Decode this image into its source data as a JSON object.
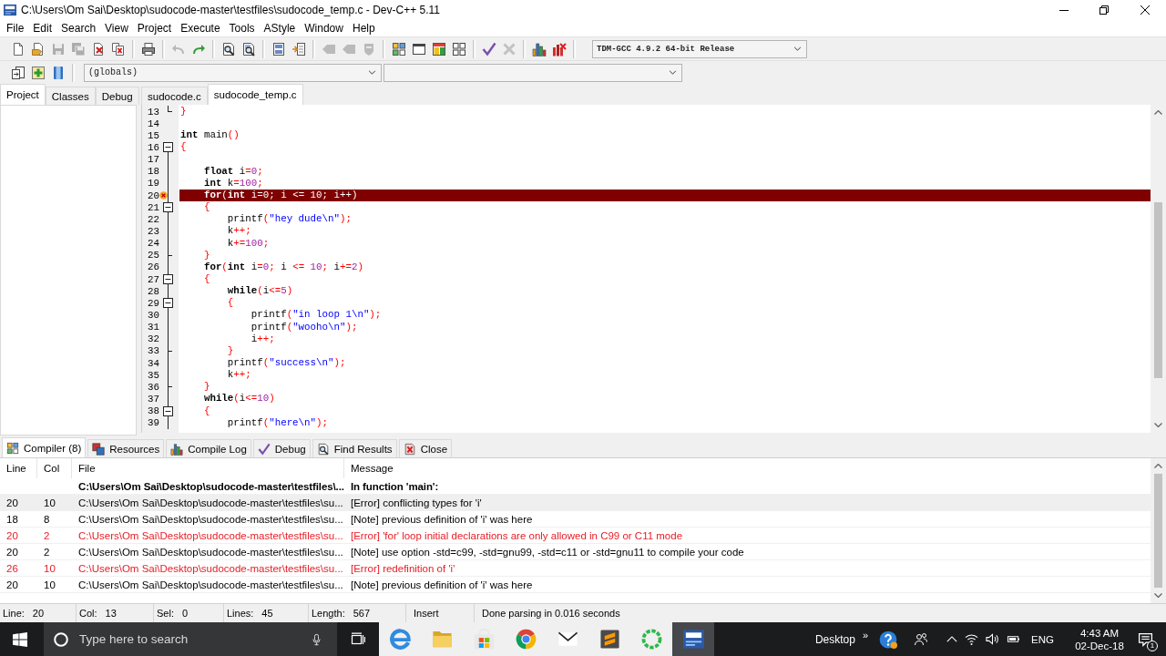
{
  "window": {
    "title": "C:\\Users\\Om Sai\\Desktop\\sudocode-master\\testfiles\\sudocode_temp.c - Dev-C++ 5.11"
  },
  "menu": [
    "File",
    "Edit",
    "Search",
    "View",
    "Project",
    "Execute",
    "Tools",
    "AStyle",
    "Window",
    "Help"
  ],
  "toolbar": {
    "groups": [
      [
        {
          "disabled": false
        },
        {
          "disabled": false
        },
        {
          "disabled": true
        },
        {
          "disabled": true
        },
        {
          "disabled": false
        },
        {
          "disabled": false
        }
      ],
      [
        {
          "disabled": false
        }
      ],
      [
        {
          "disabled": true
        },
        {
          "disabled": false
        }
      ],
      [
        {
          "disabled": false
        },
        {
          "disabled": false
        }
      ],
      [
        {
          "disabled": false
        },
        {
          "disabled": false
        }
      ],
      [
        {
          "disabled": true
        },
        {
          "disabled": true
        },
        {
          "disabled": true
        }
      ],
      [
        {
          "disabled": false
        },
        {
          "disabled": false
        },
        {
          "disabled": false
        },
        {
          "disabled": false
        }
      ],
      [
        {
          "disabled": false
        },
        {
          "disabled": true
        }
      ],
      [
        {
          "disabled": false
        },
        {
          "disabled": false
        }
      ]
    ],
    "compiler": "TDM-GCC 4.9.2 64-bit Release"
  },
  "toolbar_2": {
    "buttons": [
      {
        "disabled": false
      },
      {
        "disabled": false
      },
      {
        "disabled": false
      }
    ],
    "scope": "(globals)"
  },
  "side_panel": {
    "tabs": [
      {
        "label": "Project",
        "selected": true
      },
      {
        "label": "Classes",
        "selected": false
      },
      {
        "label": "Debug",
        "selected": false
      }
    ]
  },
  "editor": {
    "tabs": [
      {
        "label": "sudocode.c",
        "selected": false
      },
      {
        "label": "sudocode_temp.c",
        "selected": true
      }
    ],
    "lines": [
      {
        "number": "13",
        "kind": "fold-end",
        "error": false,
        "tokens": [
          {
            "kind": "symbol",
            "text": "}"
          }
        ]
      },
      {
        "number": "14",
        "kind": "plain",
        "error": false
      },
      {
        "number": "15",
        "kind": "plain",
        "error": false,
        "tokens": [
          {
            "kind": "keyword",
            "text": "int"
          },
          {
            "kind": "plain",
            "text": " main"
          },
          {
            "kind": "symbol",
            "text": "()"
          }
        ]
      },
      {
        "number": "16",
        "kind": "fold-start",
        "error": false,
        "tokens": [
          {
            "kind": "symbol",
            "text": "{"
          }
        ]
      },
      {
        "number": "17",
        "kind": "fold-inside",
        "error": false
      },
      {
        "number": "18",
        "kind": "fold-inside",
        "error": false,
        "tokens": [
          {
            "kind": "keyword",
            "text": "    float"
          },
          {
            "kind": "plain",
            "text": " i"
          },
          {
            "kind": "symbol",
            "text": "="
          },
          {
            "kind": "number",
            "text": "0"
          },
          {
            "kind": "symbol",
            "text": ";"
          }
        ]
      },
      {
        "number": "19",
        "kind": "fold-inside",
        "error": false,
        "tokens": [
          {
            "kind": "keyword",
            "text": "    int"
          },
          {
            "kind": "plain",
            "text": " k"
          },
          {
            "kind": "symbol",
            "text": "="
          },
          {
            "kind": "number",
            "text": "100"
          },
          {
            "kind": "symbol",
            "text": ";"
          }
        ]
      },
      {
        "number": "20",
        "kind": "fold-inside",
        "error": true,
        "tokens": [
          {
            "kind": "keyword",
            "text": "    for"
          },
          {
            "kind": "symbol",
            "text": "("
          },
          {
            "kind": "keyword",
            "text": "int"
          },
          {
            "kind": "plain",
            "text": " i"
          },
          {
            "kind": "symbol",
            "text": "="
          },
          {
            "kind": "number",
            "text": "0"
          },
          {
            "kind": "symbol",
            "text": ";"
          },
          {
            "kind": "plain",
            "text": " i "
          },
          {
            "kind": "symbol",
            "text": "<="
          },
          {
            "kind": "number",
            "text": " 10"
          },
          {
            "kind": "symbol",
            "text": ";"
          },
          {
            "kind": "plain",
            "text": " i"
          },
          {
            "kind": "symbol",
            "text": "++)"
          }
        ]
      },
      {
        "number": "21",
        "kind": "fold-start",
        "error": false,
        "tokens": [
          {
            "kind": "symbol",
            "text": "    {"
          }
        ]
      },
      {
        "number": "22",
        "kind": "fold-inside",
        "error": false,
        "tokens": [
          {
            "kind": "plain",
            "text": "        printf"
          },
          {
            "kind": "symbol",
            "text": "("
          },
          {
            "kind": "string",
            "text": "\"hey dude\\n\""
          },
          {
            "kind": "symbol",
            "text": ");"
          }
        ]
      },
      {
        "number": "23",
        "kind": "fold-inside",
        "error": false,
        "tokens": [
          {
            "kind": "plain",
            "text": "        k"
          },
          {
            "kind": "symbol",
            "text": "++;"
          }
        ]
      },
      {
        "number": "24",
        "kind": "fold-inside",
        "error": false,
        "tokens": [
          {
            "kind": "plain",
            "text": "        k"
          },
          {
            "kind": "symbol",
            "text": "+="
          },
          {
            "kind": "number",
            "text": "100"
          },
          {
            "kind": "symbol",
            "text": ";"
          }
        ]
      },
      {
        "number": "25",
        "kind": "fold-branch",
        "error": false,
        "tokens": [
          {
            "kind": "symbol",
            "text": "    }"
          }
        ]
      },
      {
        "number": "26",
        "kind": "fold-inside",
        "error": false,
        "tokens": [
          {
            "kind": "keyword",
            "text": "    for"
          },
          {
            "kind": "symbol",
            "text": "("
          },
          {
            "kind": "keyword",
            "text": "int"
          },
          {
            "kind": "plain",
            "text": " i"
          },
          {
            "kind": "symbol",
            "text": "="
          },
          {
            "kind": "number",
            "text": "0"
          },
          {
            "kind": "symbol",
            "text": ";"
          },
          {
            "kind": "plain",
            "text": " i "
          },
          {
            "kind": "symbol",
            "text": "<="
          },
          {
            "kind": "number",
            "text": " 10"
          },
          {
            "kind": "symbol",
            "text": ";"
          },
          {
            "kind": "plain",
            "text": " i"
          },
          {
            "kind": "symbol",
            "text": "+="
          },
          {
            "kind": "number",
            "text": "2"
          },
          {
            "kind": "symbol",
            "text": ")"
          }
        ]
      },
      {
        "number": "27",
        "kind": "fold-start",
        "error": false,
        "tokens": [
          {
            "kind": "symbol",
            "text": "    {"
          }
        ]
      },
      {
        "number": "28",
        "kind": "fold-inside",
        "error": false,
        "tokens": [
          {
            "kind": "keyword",
            "text": "        while"
          },
          {
            "kind": "symbol",
            "text": "("
          },
          {
            "kind": "plain",
            "text": "i"
          },
          {
            "kind": "symbol",
            "text": "<="
          },
          {
            "kind": "number",
            "text": "5"
          },
          {
            "kind": "symbol",
            "text": ")"
          }
        ]
      },
      {
        "number": "29",
        "kind": "fold-start",
        "error": false,
        "tokens": [
          {
            "kind": "symbol",
            "text": "        {"
          }
        ]
      },
      {
        "number": "30",
        "kind": "fold-inside",
        "error": false,
        "tokens": [
          {
            "kind": "plain",
            "text": "            printf"
          },
          {
            "kind": "symbol",
            "text": "("
          },
          {
            "kind": "string",
            "text": "\"in loop 1\\n\""
          },
          {
            "kind": "symbol",
            "text": ");"
          }
        ]
      },
      {
        "number": "31",
        "kind": "fold-inside",
        "error": false,
        "tokens": [
          {
            "kind": "plain",
            "text": "            printf"
          },
          {
            "kind": "symbol",
            "text": "("
          },
          {
            "kind": "string",
            "text": "\"wooho\\n\""
          },
          {
            "kind": "symbol",
            "text": ");"
          }
        ]
      },
      {
        "number": "32",
        "kind": "fold-inside",
        "error": false,
        "tokens": [
          {
            "kind": "plain",
            "text": "            i"
          },
          {
            "kind": "symbol",
            "text": "++;"
          }
        ]
      },
      {
        "number": "33",
        "kind": "fold-branch",
        "error": false,
        "tokens": [
          {
            "kind": "symbol",
            "text": "        }"
          }
        ]
      },
      {
        "number": "34",
        "kind": "fold-inside",
        "error": false,
        "tokens": [
          {
            "kind": "plain",
            "text": "        printf"
          },
          {
            "kind": "symbol",
            "text": "("
          },
          {
            "kind": "string",
            "text": "\"success\\n\""
          },
          {
            "kind": "symbol",
            "text": ");"
          }
        ]
      },
      {
        "number": "35",
        "kind": "fold-inside",
        "error": false,
        "tokens": [
          {
            "kind": "plain",
            "text": "        k"
          },
          {
            "kind": "symbol",
            "text": "++;"
          }
        ]
      },
      {
        "number": "36",
        "kind": "fold-branch",
        "error": false,
        "tokens": [
          {
            "kind": "symbol",
            "text": "    }"
          }
        ]
      },
      {
        "number": "37",
        "kind": "fold-inside",
        "error": false,
        "tokens": [
          {
            "kind": "keyword",
            "text": "    while"
          },
          {
            "kind": "symbol",
            "text": "("
          },
          {
            "kind": "plain",
            "text": "i"
          },
          {
            "kind": "symbol",
            "text": "<="
          },
          {
            "kind": "number",
            "text": "10"
          },
          {
            "kind": "symbol",
            "text": ")"
          }
        ]
      },
      {
        "number": "38",
        "kind": "fold-start",
        "error": false,
        "tokens": [
          {
            "kind": "symbol",
            "text": "    {"
          }
        ]
      },
      {
        "number": "39",
        "kind": "fold-inside",
        "error": false,
        "tokens": [
          {
            "kind": "plain",
            "text": "        printf"
          },
          {
            "kind": "symbol",
            "text": "("
          },
          {
            "kind": "string",
            "text": "\"here\\n\""
          },
          {
            "kind": "symbol",
            "text": ");"
          }
        ]
      }
    ]
  },
  "output_panel": {
    "tabs": [
      {
        "label": "Compiler (8)",
        "selected": true
      },
      {
        "label": "Resources",
        "selected": false
      },
      {
        "label": "Compile Log",
        "selected": false
      },
      {
        "label": "Debug",
        "selected": false
      },
      {
        "label": "Find Results",
        "selected": false
      },
      {
        "label": "Close",
        "selected": false
      }
    ],
    "table": {
      "columns": [
        "Line",
        "Col",
        "File",
        "Message"
      ],
      "rows": [
        {
          "kind": "context",
          "selected": false,
          "color": "#000000",
          "file": "C:\\Users\\Om Sai\\Desktop\\sudocode-master\\testfiles\\...",
          "message": "In function 'main':"
        },
        {
          "kind": "message",
          "selected": true,
          "color": "#000000",
          "line": "20",
          "col": "10",
          "file": "C:\\Users\\Om Sai\\Desktop\\sudocode-master\\testfiles\\su...",
          "message": "[Error] conflicting types for 'i'"
        },
        {
          "kind": "message",
          "selected": false,
          "color": "#000000",
          "line": "18",
          "col": "8",
          "file": "C:\\Users\\Om Sai\\Desktop\\sudocode-master\\testfiles\\su...",
          "message": "[Note] previous definition of 'i' was here"
        },
        {
          "kind": "message",
          "selected": false,
          "color": "#e81c24",
          "line": "20",
          "col": "2",
          "file": "C:\\Users\\Om Sai\\Desktop\\sudocode-master\\testfiles\\su...",
          "message": "[Error] 'for' loop initial declarations are only allowed in C99 or C11 mode"
        },
        {
          "kind": "message",
          "selected": false,
          "color": "#000000",
          "line": "20",
          "col": "2",
          "file": "C:\\Users\\Om Sai\\Desktop\\sudocode-master\\testfiles\\su...",
          "message": "[Note] use option -std=c99, -std=gnu99, -std=c11 or -std=gnu11 to compile your code"
        },
        {
          "kind": "message",
          "selected": false,
          "color": "#e81c24",
          "line": "26",
          "col": "10",
          "file": "C:\\Users\\Om Sai\\Desktop\\sudocode-master\\testfiles\\su...",
          "message": "[Error] redefinition of 'i'"
        },
        {
          "kind": "message",
          "selected": false,
          "color": "#000000",
          "line": "20",
          "col": "10",
          "file": "C:\\Users\\Om Sai\\Desktop\\sudocode-master\\testfiles\\su...",
          "message": "[Note] previous definition of 'i' was here"
        }
      ]
    }
  },
  "status_bar": {
    "fields": [
      {
        "label": "Line:",
        "value": "20"
      },
      {
        "label": "Col:",
        "value": "13"
      },
      {
        "label": "Sel:",
        "value": "0"
      },
      {
        "label": "Lines:",
        "value": "45"
      },
      {
        "label": "Length:",
        "value": "567"
      }
    ],
    "mode": "Insert",
    "message": "Done parsing in 0.016 seconds"
  },
  "taskbar": {
    "search": {
      "placeholder": "Type here to search"
    },
    "apps": [
      {
        "selected": false
      },
      {
        "selected": false
      },
      {
        "selected": false
      },
      {
        "selected": false
      },
      {
        "selected": false
      },
      {
        "selected": false
      },
      {
        "selected": false
      },
      {
        "selected": true
      }
    ],
    "toolbar_label": "Desktop",
    "overflow": "»",
    "language": "ENG",
    "time": "4:43 AM",
    "date": "02-Dec-18",
    "notification_count": "1"
  }
}
